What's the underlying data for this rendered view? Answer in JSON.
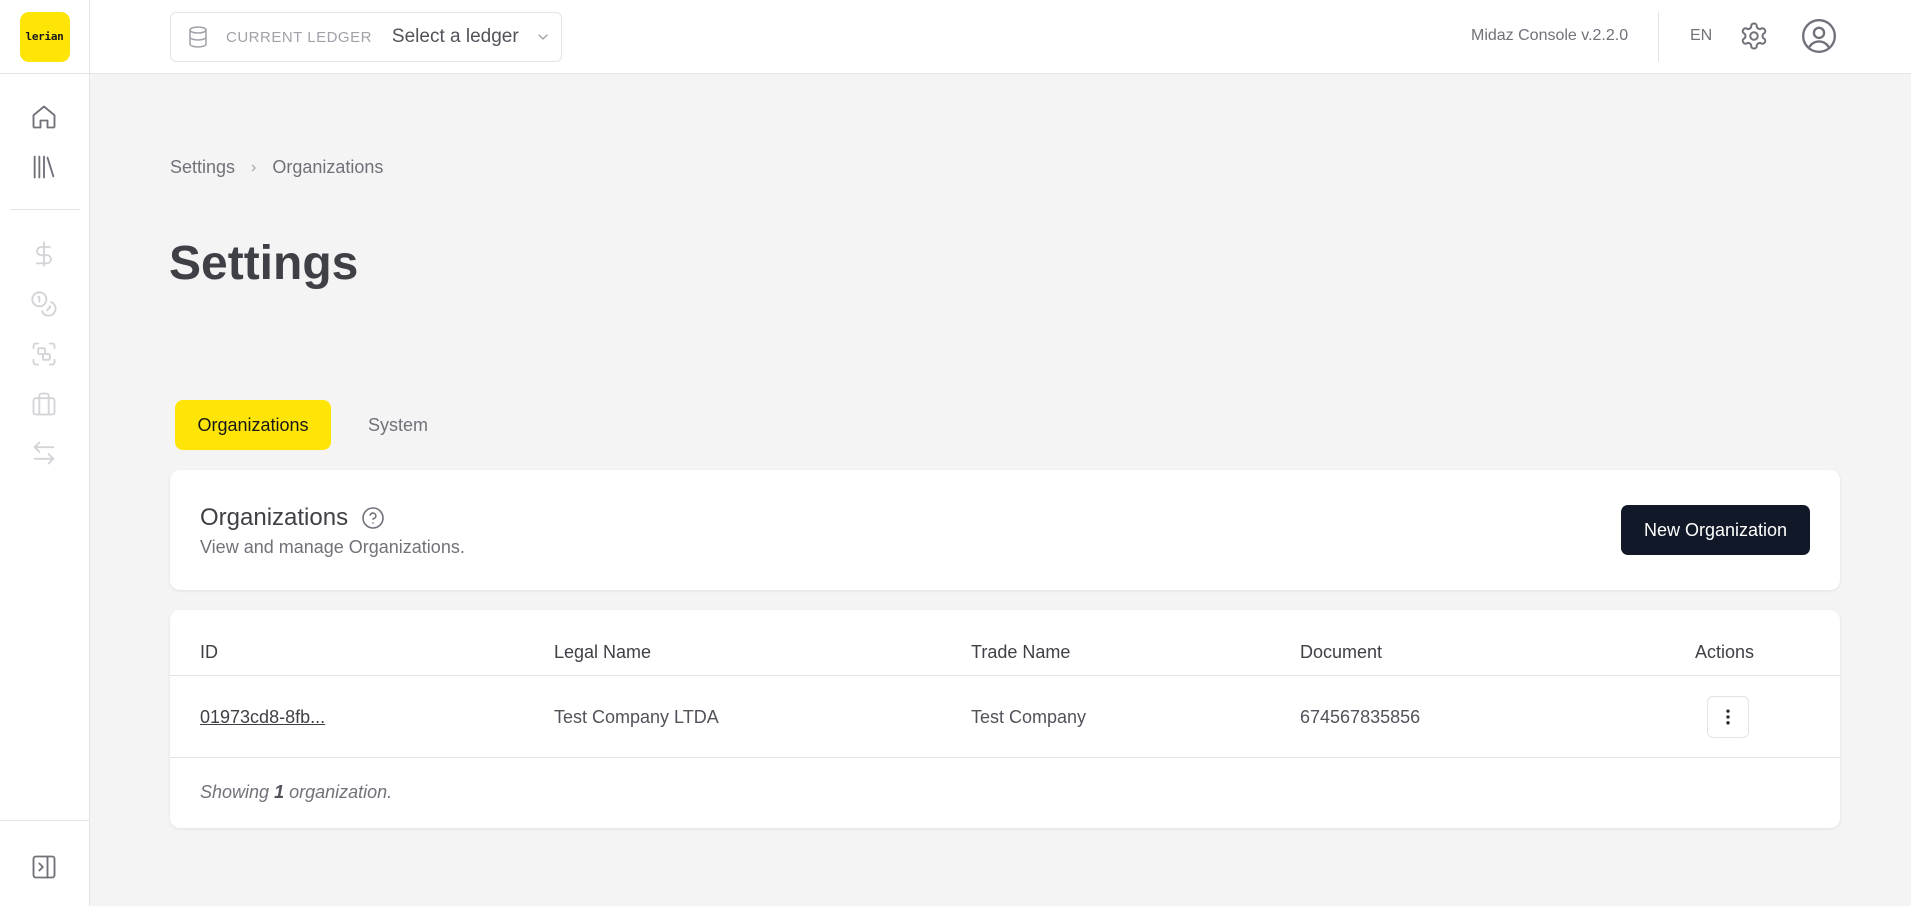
{
  "app": {
    "logo_text": "lerian",
    "version": "Midaz Console v.2.2.0",
    "language": "EN"
  },
  "ledger": {
    "label": "CURRENT LEDGER",
    "value": "Select a ledger"
  },
  "sidebar": {
    "items": [
      {
        "name": "home",
        "icon": "home-icon"
      },
      {
        "name": "ledgers",
        "icon": "library-icon"
      },
      {
        "name": "assets",
        "icon": "dollar-icon"
      },
      {
        "name": "accounts",
        "icon": "coins-icon"
      },
      {
        "name": "segments",
        "icon": "scan-group-icon"
      },
      {
        "name": "portfolios",
        "icon": "briefcase-icon"
      },
      {
        "name": "transactions",
        "icon": "arrows-swap-icon"
      }
    ],
    "collapse_icon": "panel-collapse-icon"
  },
  "breadcrumb": [
    "Settings",
    "Organizations"
  ],
  "page": {
    "title": "Settings"
  },
  "tabs": [
    {
      "label": "Organizations",
      "active": true
    },
    {
      "label": "System",
      "active": false
    }
  ],
  "organizations_card": {
    "title": "Organizations",
    "subtitle": "View and manage Organizations.",
    "new_button": "New Organization"
  },
  "table": {
    "columns": [
      "ID",
      "Legal Name",
      "Trade Name",
      "Document",
      "Actions"
    ],
    "rows": [
      {
        "id": "01973cd8-8fb...",
        "legal_name": "Test Company LTDA",
        "trade_name": "Test Company",
        "document": "674567835856"
      }
    ],
    "footer": {
      "prefix": "Showing",
      "count": "1",
      "suffix": "organization."
    }
  },
  "colors": {
    "accent": "#fee505",
    "primary_button": "#111827",
    "background": "#f4f4f5"
  }
}
